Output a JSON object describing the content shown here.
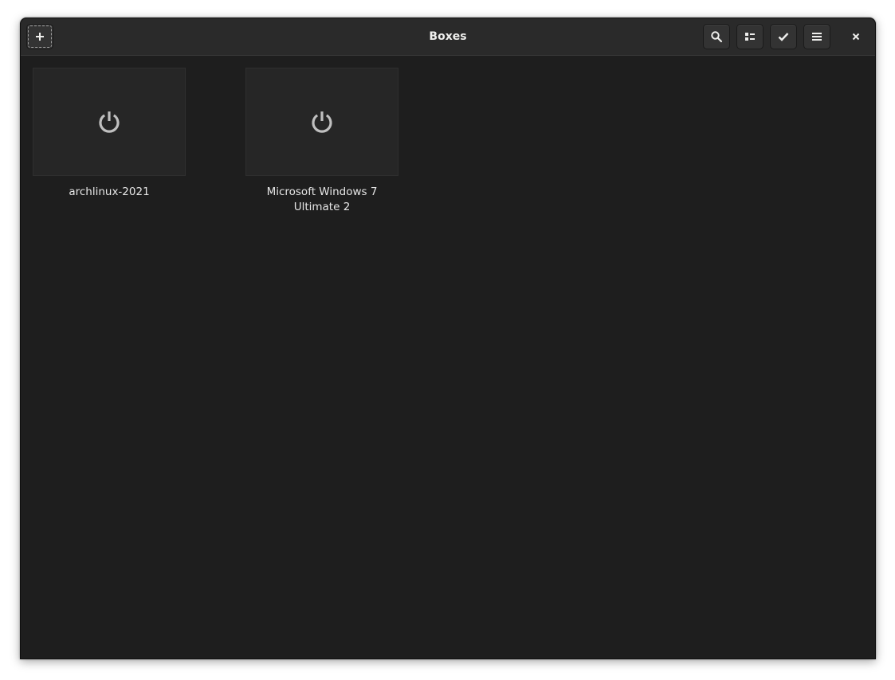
{
  "window": {
    "title": "Boxes"
  },
  "headerbar": {
    "new_button_icon": "plus-icon",
    "search_button_icon": "search-icon",
    "view_toggle_icon": "list-view-icon",
    "select_mode_icon": "checkmark-icon",
    "menu_icon": "hamburger-menu-icon",
    "close_icon": "close-icon"
  },
  "machines": [
    {
      "name": "archlinux-2021",
      "state_icon": "power-icon"
    },
    {
      "name": "Microsoft Windows 7 Ultimate 2",
      "state_icon": "power-icon"
    }
  ],
  "colors": {
    "window_bg": "#1e1e1e",
    "headerbar_bg": "#2a2a2a",
    "thumbnail_bg": "#262626",
    "text": "#eeeeec",
    "icon": "#c0c0c0"
  }
}
